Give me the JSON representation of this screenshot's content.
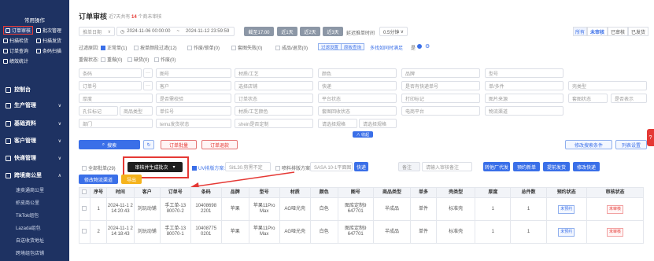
{
  "sidebar": {
    "common_title": "常用操作",
    "quick": [
      {
        "label": "订单审核"
      },
      {
        "label": "批次管理"
      },
      {
        "label": "扫描检货"
      },
      {
        "label": "扫描发货"
      },
      {
        "label": "订单查询"
      },
      {
        "label": "条码扫描"
      },
      {
        "label": "绩效统计"
      }
    ],
    "nav": [
      {
        "label": "控制台"
      },
      {
        "label": "生产管理"
      },
      {
        "label": "基础资料"
      },
      {
        "label": "客户管理"
      },
      {
        "label": "快递管理"
      },
      {
        "label": "跨境商公里"
      }
    ],
    "sub": [
      {
        "label": "速卖通商公里"
      },
      {
        "label": "虾皮商公里"
      },
      {
        "label": "TikTok组包"
      },
      {
        "label": "Lazada组包"
      },
      {
        "label": "自送收货地址"
      },
      {
        "label": "跨境组包店铺"
      }
    ]
  },
  "header": {
    "title": "订单审核",
    "sub_prefix": "近7天共有",
    "count": "14",
    "sub_suffix": "个商未审核"
  },
  "status_tabs": [
    "所有",
    "未审核",
    "已审核",
    "已发货"
  ],
  "filters": {
    "date_type": "推单日期",
    "date_start": "2024-11-06 00:00:00",
    "date_sep": "~",
    "date_end": "2024-11-12 23:59:59",
    "quick_btns": [
      "截至17:00",
      "近1天",
      "近2天",
      "近3天"
    ],
    "delay_label": "延迟推单时间",
    "delay_value": "0.5分钟",
    "row2_label": "过滤原因:",
    "row2_checks": [
      "正常单(1)",
      "按单颜段过滤(12)",
      "作废/锁单(0)",
      "套图失败(0)",
      "成品/退货(0)"
    ],
    "row2_tags": [
      "过滤设置",
      "原板查询"
    ],
    "row2_link": "多找如同时满足",
    "row2_yes": "是",
    "row3_label": "重做状态:",
    "row3_checks": [
      "重做(0)",
      "缺货(0)",
      "作废(0)"
    ]
  },
  "search_rows": [
    [
      "条码",
      "图号",
      "材质/工艺",
      "颜色",
      "品牌",
      "型号"
    ],
    [
      "订单号",
      "客户",
      "选择店铺",
      "快递",
      "是否有快递单号",
      "单/多件"
    ],
    [
      "厚度",
      "是否需校验",
      "订单状态",
      "平台状态",
      "打印标记",
      "图片来源",
      "套图状态",
      "是否表示"
    ],
    [
      "孔位标记",
      "商品类型",
      "单位号",
      "材质/工艺颜色",
      "套图回收状态",
      "电商平台",
      "物流渠道"
    ],
    [
      "部门",
      "temu发货状态",
      "shein是否定制",
      "请选择规格",
      "请选择规格"
    ]
  ],
  "actions": {
    "search": "搜索",
    "reset": "↻",
    "export_order": "订单批量",
    "export_items": "订单退款",
    "collapse": "∧ 收起",
    "modify_search": "修改搜索条件",
    "list_settings": "列表设置"
  },
  "toolbar": {
    "select_all": "全部批单(29)",
    "batch_btn": "审核并生成批次",
    "batch_arrow": "▾",
    "uv_label": "UV排版方案:",
    "uv_value": "SitL30.剪黑不定",
    "laser_label": "喷料排版方案:",
    "laser_value": "SASA 10-1平面图...",
    "express": "快递",
    "remark_select": "备注",
    "remark_placeholder": "请输入审核备注",
    "btns": [
      "转他厂代发",
      "预约新单",
      "提前发货",
      "修改快递"
    ]
  },
  "toolbar2": {
    "btns": [
      "修改物流渠道",
      "导出"
    ]
  },
  "table": {
    "headers": [
      "",
      "序号",
      "时间",
      "客户",
      "订单号",
      "条码",
      "品牌",
      "型号",
      "材质",
      "颜色",
      "图号",
      "商品类型",
      "单多",
      "壳类型",
      "厚度",
      "总件数",
      "预约状态",
      "审核状态"
    ],
    "rows": [
      [
        "",
        "1",
        "2024-11-1 2 14:20:43",
        "刘玩动铺",
        "手工单-13 80070-2",
        "10408698 2201",
        "苹果",
        "苹果11Pro Max",
        "AG哑光壳",
        "白色",
        "图库定制9 647701",
        "半成品",
        "单件",
        "标准壳",
        "1",
        "1",
        "未预约",
        "未审核"
      ],
      [
        "",
        "2",
        "2024-11-1 2 14:18:43",
        "刘玩动铺",
        "手工单-13 80070-1",
        "10408775 0201",
        "苹果",
        "苹果11Pro Max",
        "AG哑光壳",
        "白色",
        "图库定制9 647701",
        "半成品",
        "单件",
        "标准壳",
        "1",
        "1",
        "未预约",
        "未审核"
      ]
    ]
  },
  "colors": {
    "accent": "#3a6fe8",
    "sidebar": "#1e3262",
    "highlight": "#e53935"
  }
}
